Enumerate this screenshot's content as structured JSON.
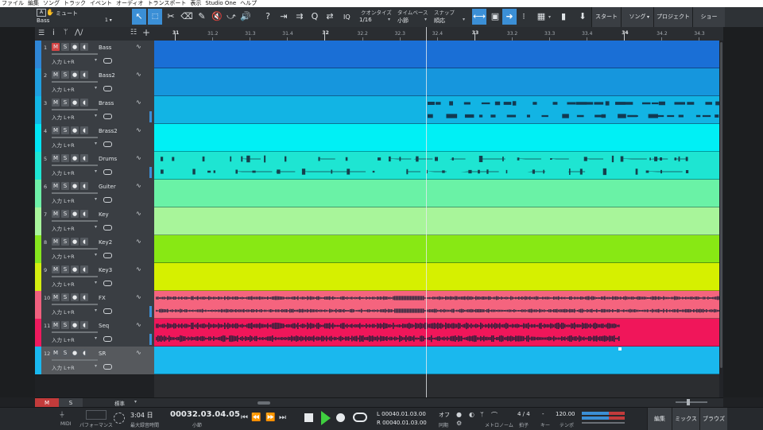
{
  "menu": [
    "ファイル",
    "編集",
    "ソング",
    "トラック",
    "イベント",
    "オーディオ",
    "トランスポート",
    "表示",
    "Studio One",
    "ヘルプ"
  ],
  "toolbar": {
    "channel_label": "ミュート",
    "track_name": "Bass",
    "track_index": "1 ▾",
    "iq": "IQ",
    "quantize_label": "クオンタイズ",
    "quantize_value": "1/16",
    "timebase_label": "タイムベース",
    "timebase_value": "小節",
    "snap_label": "スナップ",
    "snap_value": "順応",
    "start": "スタート",
    "song": "ソング",
    "project": "プロジェクト",
    "show": "ショー"
  },
  "ruler": {
    "ticks": [
      {
        "label": "31",
        "major": true
      },
      {
        "label": "31.2",
        "major": false
      },
      {
        "label": "31.3",
        "major": false
      },
      {
        "label": "31.4",
        "major": false
      },
      {
        "label": "32",
        "major": true
      },
      {
        "label": "32.2",
        "major": false
      },
      {
        "label": "32.3",
        "major": false
      },
      {
        "label": "32.4",
        "major": false
      },
      {
        "label": "33",
        "major": true
      },
      {
        "label": "33.2",
        "major": false
      },
      {
        "label": "33.3",
        "major": false
      },
      {
        "label": "33.4",
        "major": false
      },
      {
        "label": "34",
        "major": true
      },
      {
        "label": "34.2",
        "major": false
      },
      {
        "label": "34.3",
        "major": false
      }
    ]
  },
  "tracks": [
    {
      "num": "1",
      "name": "Bass",
      "color": "#2f86d6",
      "lane": "#1a6fd6",
      "muted": true,
      "selected": false,
      "input": "入力 L+R",
      "hasLevel": false,
      "wave": "none"
    },
    {
      "num": "2",
      "name": "Bass2",
      "color": "#1f9fe0",
      "lane": "#1696dd",
      "muted": false,
      "selected": false,
      "input": "入力 L+R",
      "hasLevel": false,
      "wave": "none"
    },
    {
      "num": "3",
      "name": "Brass",
      "color": "#12b6e6",
      "lane": "#12b4e4",
      "muted": false,
      "selected": false,
      "input": "入力 L+R",
      "hasLevel": true,
      "wave": "sparse"
    },
    {
      "num": "4",
      "name": "Brass2",
      "color": "#00e5f5",
      "lane": "#00f0f5",
      "muted": false,
      "selected": false,
      "input": "入力 L+R",
      "hasLevel": false,
      "wave": "none"
    },
    {
      "num": "5",
      "name": "Drums",
      "color": "#1ee6d4",
      "lane": "#1ee5d2",
      "muted": false,
      "selected": false,
      "input": "入力 L+R",
      "hasLevel": true,
      "wave": "drums"
    },
    {
      "num": "6",
      "name": "Guiter",
      "color": "#6ef0a8",
      "lane": "#6af2a6",
      "muted": false,
      "selected": false,
      "input": "入力 L+R",
      "hasLevel": false,
      "wave": "none"
    },
    {
      "num": "7",
      "name": "Key",
      "color": "#a8f59c",
      "lane": "#a8f59a",
      "muted": false,
      "selected": false,
      "input": "入力 L+R",
      "hasLevel": false,
      "wave": "none"
    },
    {
      "num": "8",
      "name": "Key2",
      "color": "#86e61e",
      "lane": "#88e814",
      "muted": false,
      "selected": false,
      "input": "入力 L+R",
      "hasLevel": false,
      "wave": "none"
    },
    {
      "num": "9",
      "name": "Key3",
      "color": "#d4ee10",
      "lane": "#d6f000",
      "muted": false,
      "selected": false,
      "input": "入力 L+R",
      "hasLevel": false,
      "wave": "none"
    },
    {
      "num": "10",
      "name": "FX",
      "color": "#f0607e",
      "lane": "#f5647e",
      "muted": false,
      "selected": false,
      "input": "入力 L+R",
      "hasLevel": true,
      "wave": "dense"
    },
    {
      "num": "11",
      "name": "Seq",
      "color": "#ee1a5e",
      "lane": "#f0165a",
      "muted": false,
      "selected": false,
      "input": "入力 L+R",
      "hasLevel": true,
      "wave": "seq"
    },
    {
      "num": "12",
      "name": "SR",
      "color": "#19b8f0",
      "lane": "#1ab8ee",
      "muted": false,
      "selected": true,
      "input": "入力 L+R",
      "hasLevel": false,
      "wave": "none"
    }
  ],
  "bottom": {
    "m": "M",
    "s": "S",
    "mode": "標準"
  },
  "transport": {
    "midi": "MIDI",
    "performance": "パフォーマンス",
    "rec_time": "3:04 日",
    "rec_time_label": "最大録音時間",
    "position": "00032.03.04.05",
    "position_unit": "小節",
    "loop_l": "L  00040.01.03.00",
    "loop_r": "R  00040.01.03.00",
    "sync": "オフ",
    "sync_label": "同期",
    "metronome_label": "メトロノーム",
    "signature": "4 / 4",
    "signature_label": "拍子",
    "key": "-",
    "key_label": "キー",
    "tempo": "120.00",
    "tempo_label": "テンポ",
    "edit": "編集",
    "mix": "ミックス",
    "browse": "ブラウズ"
  }
}
